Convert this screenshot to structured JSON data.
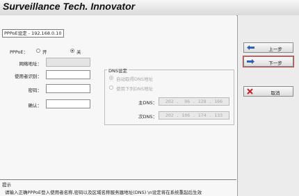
{
  "header": {
    "brand": "Surveillance Tech. Innovator"
  },
  "panel": {
    "title": "PPPoE设定 - 192.168.0.10",
    "pppoe_label": "PPPoE：",
    "option_on": "开",
    "option_off": "关",
    "pppoe_selected": "关",
    "fields": {
      "network_address": "网络地址：",
      "user_id": "使用者识别：",
      "password": "密码：",
      "confirm": "确认："
    },
    "dns": {
      "legend": "DNS设定",
      "auto_label": "自动取得DNS地址",
      "manual_label": "使用下列DNS地址",
      "primary_label": "主DNS：",
      "primary_value": " 202 .  96 . 128 . 166",
      "secondary_label": "次DNS：",
      "secondary_value": " 202 . 106 . 174 . 133"
    }
  },
  "hint": {
    "title": "提示",
    "text": "请输入正确PPPoE登入使用者名称,密码以及区域名称服务器地址(DNS) \\n设定将在系统重起后生效"
  },
  "buttons": {
    "prev": "上一步",
    "next": "下一步",
    "cancel": "取消"
  },
  "colors": {
    "arrow": "#2f61b3",
    "cancel_icon": "#c42020",
    "focus": "#cc4444"
  }
}
